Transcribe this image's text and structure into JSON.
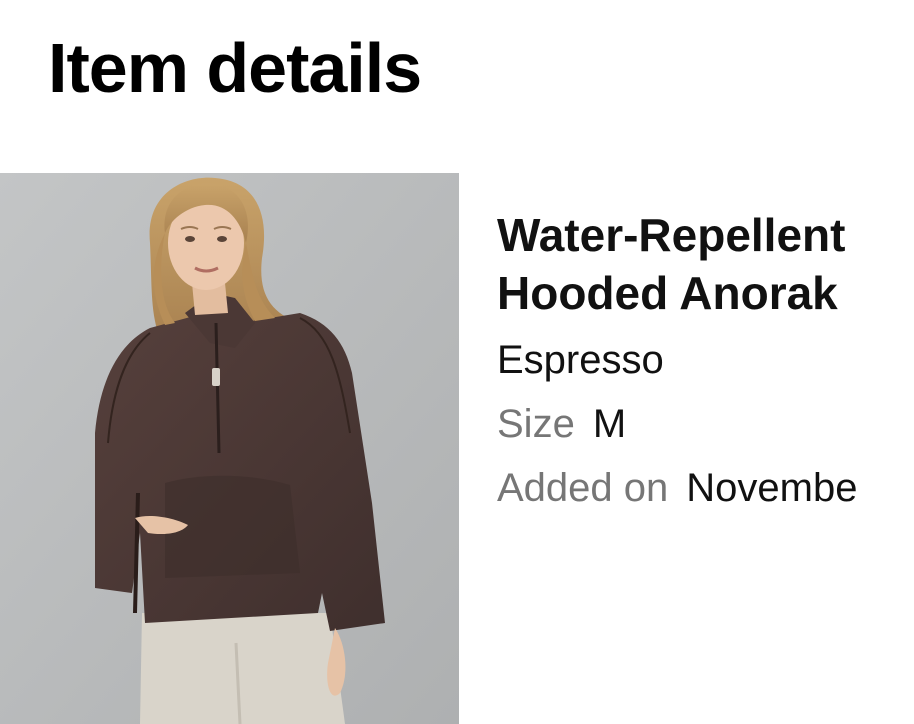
{
  "page": {
    "title": "Item details"
  },
  "product": {
    "image_icon": "product-photo",
    "name_line1": "Water-Repellent",
    "name_line2": "Hooded Anorak",
    "color": "Espresso",
    "size_label": "Size",
    "size_value": "M",
    "added_label": "Added on",
    "added_value": "Novembe"
  },
  "colors": {
    "label_gray": "#767676",
    "jacket_brown": "#4a3734",
    "background_gray": "#b9bbbc"
  }
}
